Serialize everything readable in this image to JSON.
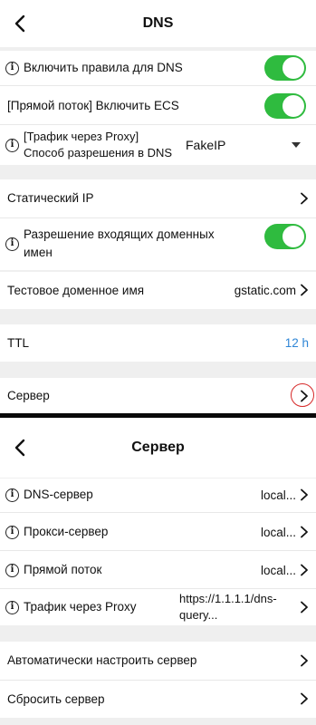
{
  "dns": {
    "title": "DNS",
    "rows": {
      "dns_rules": {
        "label": "Включить правила для DNS",
        "enabled": true
      },
      "ecs": {
        "label": "[Прямой поток] Включить ECS",
        "enabled": true
      },
      "proxy_resolution": {
        "label_line1": "[Трафик через Proxy]",
        "label_line2": "Способ разрешения в DNS",
        "value": "FakeIP"
      },
      "static_ip": {
        "label": "Статический IP"
      },
      "inbound_domains": {
        "label_line1": "Разрешение входящих доменных",
        "label_line2": "имен",
        "enabled": true
      },
      "test_domain": {
        "label": "Тестовое доменное имя",
        "value": "gstatic.com"
      },
      "ttl": {
        "label": "TTL",
        "value": "12 h"
      },
      "server": {
        "label": "Сервер"
      }
    }
  },
  "server_screen": {
    "title": "Сервер",
    "rows": {
      "dns_server": {
        "label": "DNS-сервер",
        "value": "local..."
      },
      "proxy_server": {
        "label": "Прокси-сервер",
        "value": "local..."
      },
      "direct": {
        "label": "Прямой поток",
        "value": "local..."
      },
      "proxy_traffic": {
        "label": "Трафик через Proxy",
        "value_line1": "https://1.1.1.1/dns-",
        "value_line2": "query..."
      },
      "auto_configure": {
        "label": "Автоматически настроить сервер"
      },
      "reset": {
        "label": "Сбросить сервер"
      }
    }
  },
  "colors": {
    "toggle_on": "#2fbb3f",
    "ttl_value": "#2f86d6",
    "highlight_circle": "#d62828"
  }
}
